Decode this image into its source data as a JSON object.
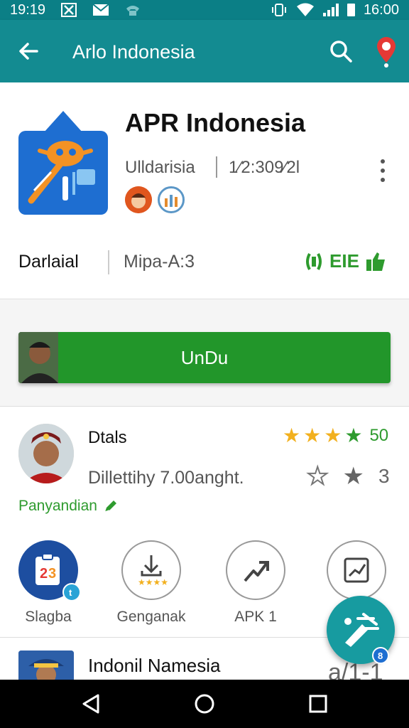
{
  "status_bar": {
    "time_left": "19:19",
    "time_right": "16:00",
    "icons": [
      "x-icon",
      "mail-icon",
      "phone-icon",
      "vibrate-icon",
      "wifi-icon",
      "signal-icon",
      "battery-icon"
    ]
  },
  "app_bar": {
    "title": "Arlo Indonesia",
    "icons": [
      "back-arrow-icon",
      "search-icon",
      "notification-pin-icon"
    ]
  },
  "app": {
    "title": "APR Indonesia",
    "developer": "Ulldarisia",
    "version": "1⁄2:309⁄2l",
    "icons": [
      "app-logo-icon",
      "face-badge-icon",
      "chart-badge-icon",
      "more-vert-icon"
    ],
    "meta_label": "Darlaial",
    "meta_size": "Mipa-A:3",
    "meta_right": "EIE"
  },
  "install": {
    "label": "UnDu"
  },
  "review": {
    "name": "Dtals",
    "score": "50",
    "stars": 4,
    "text": "Dillettihy 7.00anght.",
    "count": "3",
    "link": "Panyandian"
  },
  "actions": [
    {
      "label": "Slagba",
      "icon": "clipboard-icon"
    },
    {
      "label": "Genganak",
      "icon": "download-rating-icon"
    },
    {
      "label": "APK 1",
      "icon": "trend-arrow-icon"
    },
    {
      "label": "",
      "icon": "chart-edit-icon"
    }
  ],
  "next_card": {
    "title": "Indonil Namesia",
    "right": "a/1-1"
  },
  "colors": {
    "app_bar": "#138b91",
    "status_bar": "#0b7f86",
    "install": "#22962a",
    "accent_green": "#2e9b2e",
    "star_gold": "#f2b01e"
  }
}
